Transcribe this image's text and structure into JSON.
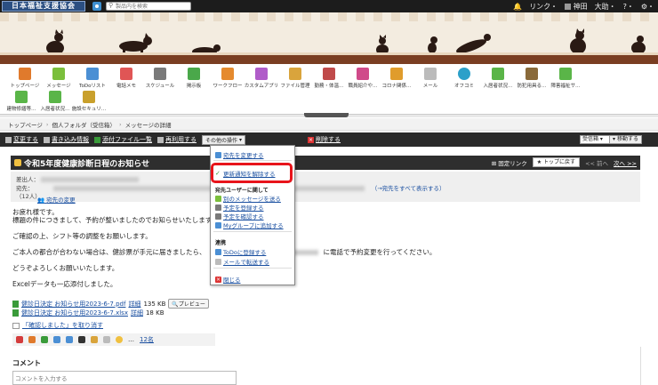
{
  "topbar": {
    "logo": "日本福祉支援協会",
    "search_placeholder": "製品内を検索",
    "link_menu": "リンク・",
    "user": "神田　大助",
    "user_suffix": "・",
    "help": "?・",
    "settings": "⚙・"
  },
  "apps": [
    {
      "label": "トップページ",
      "color": "#e07a2c"
    },
    {
      "label": "メッセージ",
      "color": "#7bbf3c"
    },
    {
      "label": "ToDoリスト",
      "color": "#4b8fd4"
    },
    {
      "label": "電話メモ",
      "color": "#e05555"
    },
    {
      "label": "スケジュール",
      "color": "#7a7a7a"
    },
    {
      "label": "掲示板",
      "color": "#4aa84a"
    },
    {
      "label": "ワークフロー",
      "color": "#e58a2e"
    },
    {
      "label": "カスタムアプリ",
      "color": "#b05cc9"
    },
    {
      "label": "ファイル管理",
      "color": "#d9a43c"
    },
    {
      "label": "勤務・体温…",
      "color": "#c04a4a"
    },
    {
      "label": "職員紹介や…",
      "color": "#d04a8a"
    },
    {
      "label": "コロナ関係…",
      "color": "#e09c2c"
    },
    {
      "label": "メール",
      "color": "#bbbbbb"
    },
    {
      "label": "オフコミ",
      "color": "#2ca0c9"
    },
    {
      "label": "入居者状況…",
      "color": "#5ab548"
    },
    {
      "label": "防犯用具る…",
      "color": "#8a6a3a"
    },
    {
      "label": "障害福祉サ…",
      "color": "#5ab548"
    },
    {
      "label": "建物修繕等…",
      "color": "#5ab548"
    },
    {
      "label": "入居者状況…",
      "color": "#5ab548"
    },
    {
      "label": "施設セキュリ…",
      "color": "#c9a02c"
    }
  ],
  "breadcrumb": [
    "トップページ",
    "個人フォルダ（受信箱）",
    "メッセージの詳細"
  ],
  "actions": {
    "edit": "変更する",
    "draft": "書き込み情報",
    "attachments": "添付ファイル一覧",
    "reuse": "再利用する",
    "other_ops": "その他の操作",
    "delete": "削除する",
    "folder": "受信箱",
    "move": "移動する"
  },
  "message": {
    "title": "令和5年度健康診断日程のお知らせ",
    "fixed_link": "固定リンク",
    "to_top": "トップに戻す",
    "prev": "<< 前へ",
    "next": "次へ >>",
    "sender_label": "差出人：",
    "recipients_label": "宛先：",
    "recipients_count": "（12人）",
    "show_all": "（→宛先をすべて表示する）",
    "change_recipients": "宛先の変更",
    "body": [
      "お疲れ様です。",
      "標題の件につきまして、予約が整いましたのでお知らせいたします",
      "",
      "ご確認の上、シフト等の調整をお願いします。",
      "",
      "ご本人の都合が合わない場合は、健診票が手元に届きましたら、",
      "",
      "どうぞよろしくお願いいたします。",
      "",
      "Excelデータも一応添付しました。"
    ],
    "body_right": "に電話で予約変更を行ってください。",
    "files": [
      {
        "name": "健診日決定 お知らせ用2023-6-7.pdf",
        "detail": "詳細",
        "size": "135 KB",
        "preview": "プレビュー"
      },
      {
        "name": "健診日決定 お知らせ用2023-6-7.xlsx",
        "detail": "詳細",
        "size": "18 KB"
      }
    ],
    "confirm": "「確認しました」を取り消す",
    "reactions_count": "12名",
    "comment_label": "コメント",
    "comment_placeholder": "コメントを入力する"
  },
  "dropdown": {
    "change_recipients": "宛先を変更する",
    "unfollow": "更新通知を解除する",
    "recipient_section": "宛先ユーザーに関して",
    "send_new": "別のメッセージを送る",
    "register_schedule": "予定を登録する",
    "check_schedule": "予定を確認する",
    "add_group": "Myグループに追加する",
    "link_section": "連携",
    "register_todo": "ToDoに登録する",
    "forward_mail": "メールで転送する",
    "close": "閉じる"
  }
}
